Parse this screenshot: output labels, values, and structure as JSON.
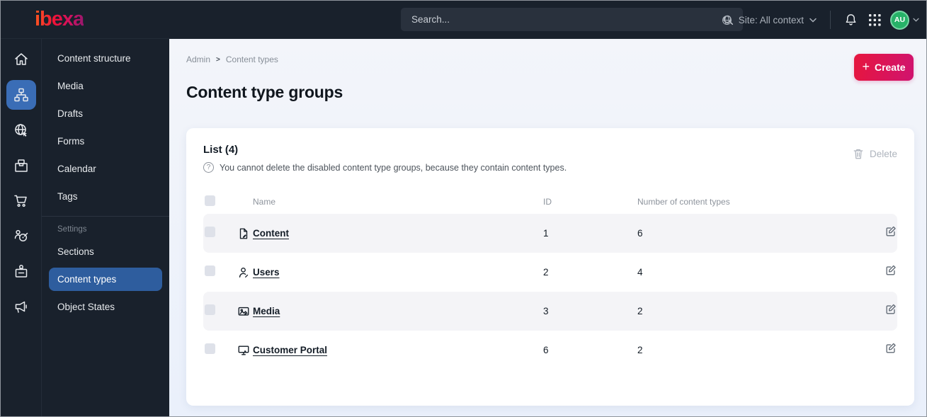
{
  "topbar": {
    "logo": "ibexa",
    "search_placeholder": "Search...",
    "site_selector": "Site: All context",
    "avatar_initials": "AU",
    "icons": [
      "search-icon",
      "globe-icon",
      "chevron-down-icon",
      "bell-icon",
      "app-grid-icon",
      "avatar-chevron-icon"
    ]
  },
  "sidebar": {
    "rail_icons": [
      {
        "icon": "home-icon",
        "active": false
      },
      {
        "icon": "content-structure-icon",
        "active": true
      },
      {
        "icon": "site-icon",
        "active": false
      },
      {
        "icon": "product-catalog-icon",
        "active": false
      },
      {
        "icon": "cart-icon",
        "active": false
      },
      {
        "icon": "customer-icon",
        "active": false
      },
      {
        "icon": "company-icon",
        "active": false
      },
      {
        "icon": "campaign-icon",
        "active": false
      }
    ],
    "menu_items": [
      {
        "label": "Content structure",
        "active": false
      },
      {
        "label": "Media",
        "active": false
      },
      {
        "label": "Drafts",
        "active": false
      },
      {
        "label": "Forms",
        "active": false
      },
      {
        "label": "Calendar",
        "active": false
      },
      {
        "label": "Tags",
        "active": false
      }
    ],
    "settings_label": "Settings",
    "settings_items": [
      {
        "label": "Sections",
        "active": false
      },
      {
        "label": "Content types",
        "active": true
      },
      {
        "label": "Object States",
        "active": false
      }
    ]
  },
  "main": {
    "breadcrumb": [
      "Admin",
      "Content types"
    ],
    "create_label": "Create",
    "page_title": "Content type groups",
    "card": {
      "title": "List (4)",
      "help_text": "You cannot delete the disabled content type groups, because they contain content types.",
      "delete_label": "Delete",
      "table": {
        "headers": [
          "Name",
          "ID",
          "Number of content types"
        ],
        "rows": [
          {
            "icon": "content-file-icon",
            "name": "Content",
            "id": "1",
            "count": "6"
          },
          {
            "icon": "user-icon",
            "name": "Users",
            "id": "2",
            "count": "4"
          },
          {
            "icon": "media-image-icon",
            "name": "Media",
            "id": "3",
            "count": "2"
          },
          {
            "icon": "portal-monitor-icon",
            "name": "Customer Portal",
            "id": "6",
            "count": "2"
          }
        ]
      }
    }
  },
  "colors": {
    "topbar_bg": "#19212c",
    "active_blue": "#2e5d9e",
    "rail_active_blue": "#3a6db6",
    "accent_gradient_start": "#e6163e",
    "accent_gradient_end": "#d0136f",
    "avatar_green": "#27b268",
    "row_alt_bg": "#f4f4f7",
    "main_bg": "#f0f3fa"
  }
}
